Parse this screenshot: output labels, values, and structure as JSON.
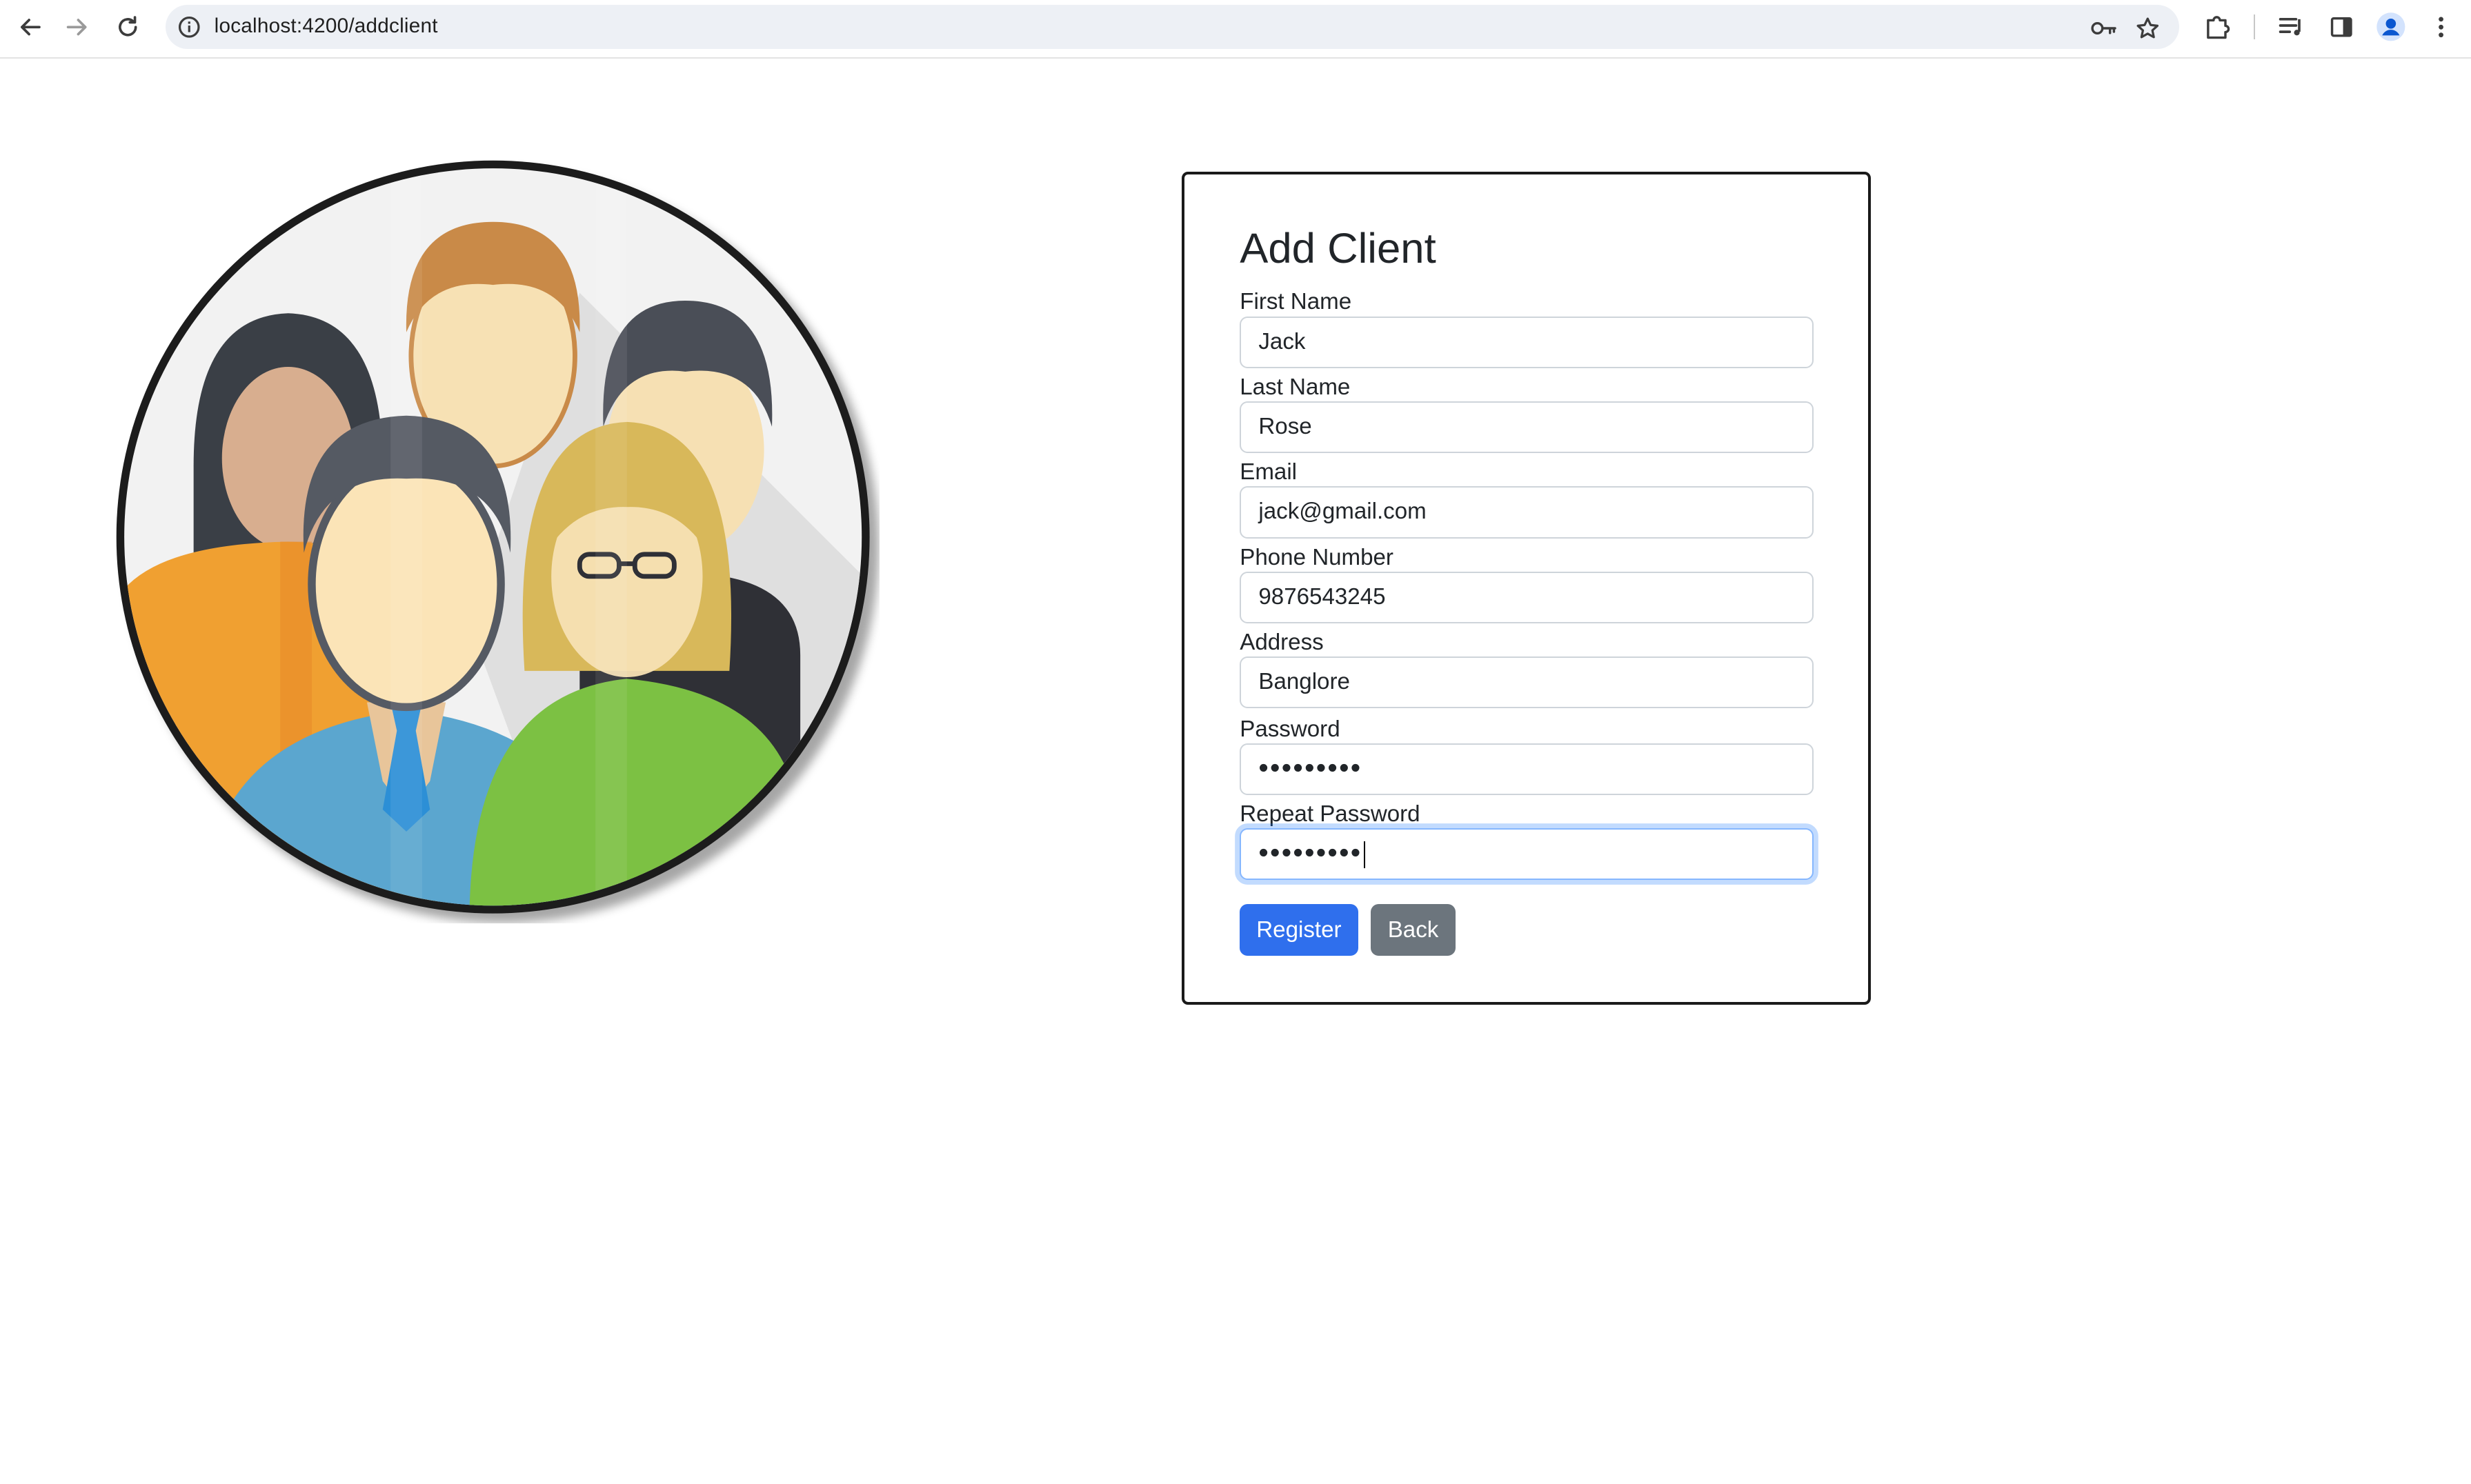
{
  "browser": {
    "url": "localhost:4200/addclient"
  },
  "form": {
    "title": "Add Client",
    "fields": [
      {
        "label": "First Name",
        "value": "Jack"
      },
      {
        "label": "Last Name",
        "value": "Rose"
      },
      {
        "label": "Email",
        "value": "jack@gmail.com"
      },
      {
        "label": "Phone Number",
        "value": "9876543245"
      },
      {
        "label": "Address",
        "value": "Banglore"
      },
      {
        "label": "Password",
        "value": "•••••••••"
      },
      {
        "label": "Repeat Password",
        "value": "•••••••••"
      }
    ],
    "register_label": "Register",
    "back_label": "Back"
  },
  "colors": {
    "primary": "#2f6fed",
    "secondary": "#6c757d",
    "focus_ring": "#86b7fe"
  },
  "icons": [
    "back-arrow-icon",
    "forward-arrow-icon",
    "reload-icon",
    "site-info-icon",
    "password-key-icon",
    "bookmark-star-icon",
    "extensions-icon",
    "media-queue-icon",
    "side-panel-icon",
    "profile-avatar-icon",
    "more-menu-icon"
  ]
}
